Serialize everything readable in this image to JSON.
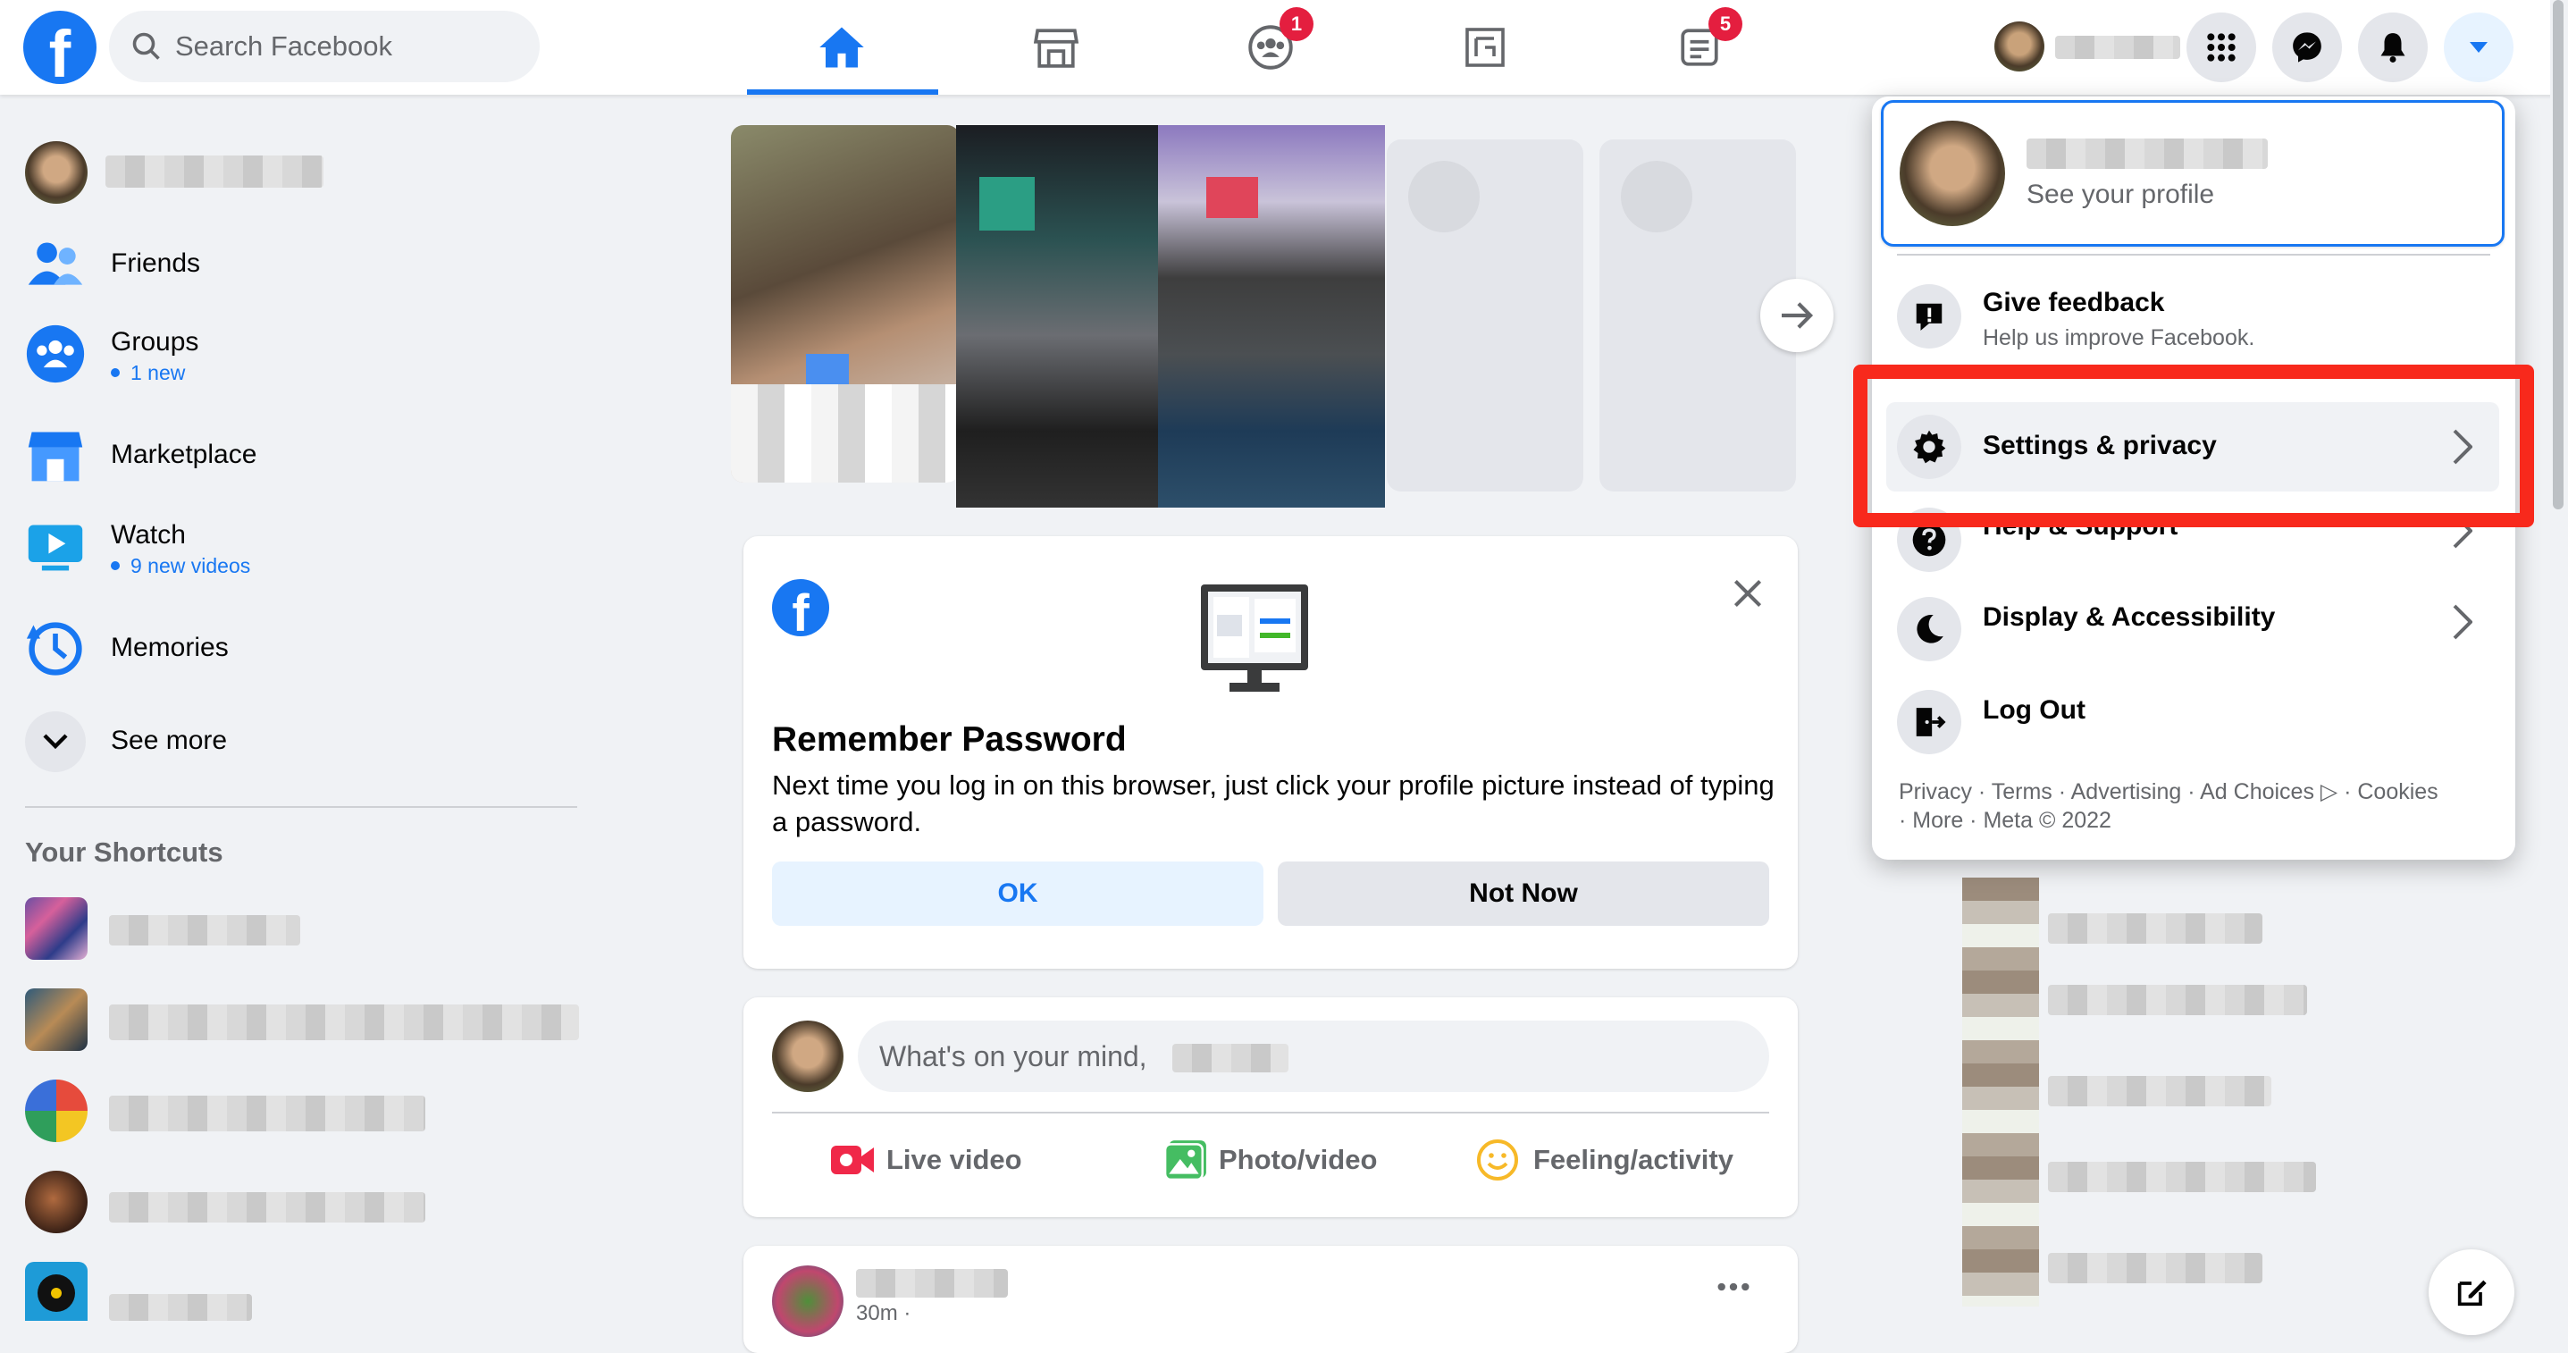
{
  "search": {
    "placeholder": "Search Facebook"
  },
  "nav": {
    "groups_badge": "1",
    "news_badge": "5"
  },
  "sidebar": {
    "items": [
      {
        "label": "Friends"
      },
      {
        "label": "Groups",
        "sub": "1 new"
      },
      {
        "label": "Marketplace"
      },
      {
        "label": "Watch",
        "sub": "9 new videos"
      },
      {
        "label": "Memories"
      },
      {
        "label": "See more"
      }
    ],
    "shortcuts_title": "Your Shortcuts"
  },
  "remember": {
    "title": "Remember Password",
    "body": "Next time you log in on this browser, just click your profile picture instead of typing a password.",
    "ok": "OK",
    "not_now": "Not Now"
  },
  "composer": {
    "placeholder": "What's on your mind,",
    "live": "Live video",
    "photo": "Photo/video",
    "feeling": "Feeling/activity"
  },
  "post": {
    "time": "30m ·"
  },
  "menu": {
    "see_profile": "See your profile",
    "feedback_title": "Give feedback",
    "feedback_sub": "Help us improve Facebook.",
    "settings": "Settings & privacy",
    "help": "Help & Support",
    "display": "Display & Accessibility",
    "logout": "Log Out",
    "footer_line1": "Privacy · Terms · Advertising · Ad Choices ▷ · Cookies",
    "footer_line2": "· More · Meta © 2022"
  },
  "colors": {
    "brand": "#1877f2",
    "highlight": "#f8291c",
    "badge": "#e41e3f"
  }
}
